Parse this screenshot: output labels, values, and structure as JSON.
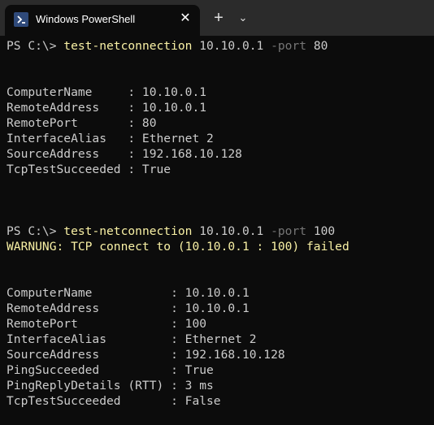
{
  "window": {
    "tab_title": "Windows PowerShell",
    "close_glyph": "✕",
    "new_tab_glyph": "+",
    "dropdown_glyph": "⌄"
  },
  "colors": {
    "background": "#0c0c0c",
    "titlebar": "#2b2b2b",
    "command": "#f9f1a5",
    "parameter": "#767676",
    "text": "#cccccc",
    "warning": "#f9f1a5"
  },
  "icons": {
    "tab_icon": "powershell-icon",
    "close": "close-icon",
    "new_tab": "plus-icon",
    "dropdown": "chevron-down-icon"
  },
  "session": {
    "prompt": "PS C:\\> ",
    "command1": {
      "name": "test-netconnection",
      "target": " 10.10.0.1 ",
      "param": "-port",
      "value": " 80"
    },
    "result1": [
      "ComputerName     : 10.10.0.1",
      "RemoteAddress    : 10.10.0.1",
      "RemotePort       : 80",
      "InterfaceAlias   : Ethernet 2",
      "SourceAddress    : 192.168.10.128",
      "TcpTestSucceeded : True"
    ],
    "command2": {
      "name": "test-netconnection",
      "target": " 10.10.0.1 ",
      "param": "-port",
      "value": " 100"
    },
    "warning": "WARNUNG: TCP connect to (10.10.0.1 : 100) failed",
    "result2": [
      "ComputerName           : 10.10.0.1",
      "RemoteAddress          : 10.10.0.1",
      "RemotePort             : 100",
      "InterfaceAlias         : Ethernet 2",
      "SourceAddress          : 192.168.10.128",
      "PingSucceeded          : True",
      "PingReplyDetails (RTT) : 3 ms",
      "TcpTestSucceeded       : False"
    ]
  }
}
